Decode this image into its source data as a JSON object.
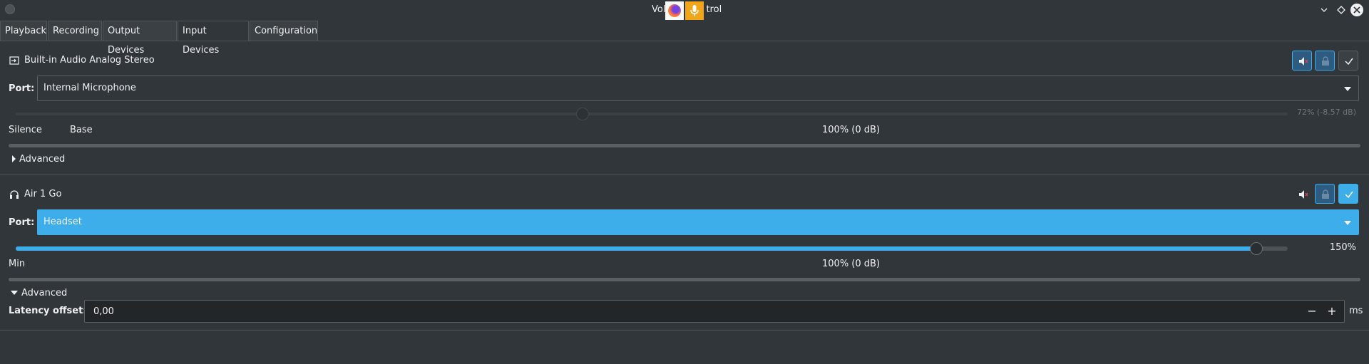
{
  "window": {
    "title_left": "Vol",
    "title_right": "trol",
    "tray_icons": [
      "firefox-icon",
      "microphone-icon"
    ]
  },
  "tabs": [
    {
      "label": "Playback",
      "active": false
    },
    {
      "label": "Recording",
      "active": false
    },
    {
      "label": "Output Devices",
      "active": false
    },
    {
      "label": "Input Devices",
      "active": true
    },
    {
      "label": "Configuration",
      "active": false
    }
  ],
  "devices": [
    {
      "name": "Built-in Audio Analog Stereo",
      "icon": "audio-input-icon",
      "port_label": "Port:",
      "port_value": "Internal Microphone",
      "volume_fraction": 0.445,
      "volume_text": "72% (-8.57 dB)",
      "scale_left": "Silence",
      "scale_mid": "Base",
      "scale_center": "100% (0 dB)",
      "advanced_label": "Advanced",
      "advanced_expanded": false,
      "muted": true,
      "locked": true,
      "default": false
    },
    {
      "name": "Air 1 Go",
      "icon": "headphones-icon",
      "port_label": "Port:",
      "port_value": "Headset",
      "volume_fraction": 0.98,
      "volume_text": "150%",
      "scale_left": "Min",
      "scale_center": "100% (0 dB)",
      "advanced_label": "Advanced",
      "advanced_expanded": true,
      "latency_label": "Latency offset:",
      "latency_value": "0,00",
      "latency_unit": "ms",
      "muted": false,
      "locked": true,
      "default": true
    }
  ],
  "colors": {
    "background": "#31363b",
    "accent": "#3daee9",
    "text": "#eff0f1"
  }
}
